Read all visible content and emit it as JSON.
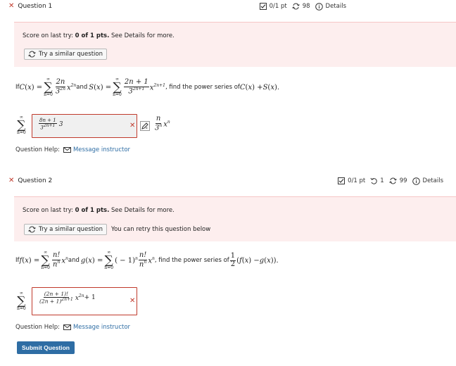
{
  "q1": {
    "title": "Question 1",
    "points": "0/1 pt",
    "retries": "98",
    "details_label": "Details",
    "score_text_pre": "Score on last try: ",
    "score_bold": "0 of 1 pts.",
    "score_text_post": " See Details for more.",
    "similar_label": "Try a similar question",
    "prompt_if": "If ",
    "prompt_and": " and ",
    "prompt_find": ", find the power series of ",
    "answer_expr_num": "8n + 1",
    "answer_expr_den": "3",
    "answer_expr_den_sup": "2n+1",
    "answer_expr_tail": "3",
    "help_label": "Question Help:",
    "message_label": "Message instructor"
  },
  "q2": {
    "title": "Question 2",
    "points": "0/1 pt",
    "attempts": "1",
    "retries": "99",
    "details_label": "Details",
    "score_text_pre": "Score on last try: ",
    "score_bold": "0 of 1 pts.",
    "score_text_post": " See Details for more.",
    "similar_label": "Try a similar question",
    "retry_note": "You can retry this question below",
    "prompt_if": "If ",
    "prompt_and": " and ",
    "prompt_find": ", find the power series of ",
    "answer_num": "(2n + 1)!",
    "answer_den": "(2n + 1)",
    "answer_den_sup": "2n+1",
    "answer_tail_sup": "2n",
    "answer_tail": " + 1",
    "help_label": "Question Help:",
    "message_label": "Message instructor"
  },
  "submit_label": "Submit Question",
  "colors": {
    "wrong": "#c0392b",
    "link": "#2e6da4",
    "banner": "#fdeeee"
  }
}
